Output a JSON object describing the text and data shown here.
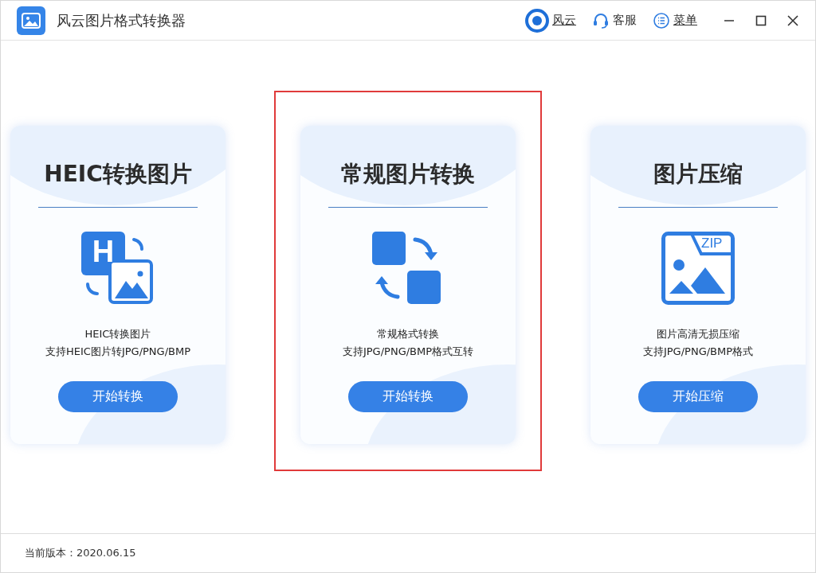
{
  "window": {
    "title": "风云图片格式转换器"
  },
  "header_links": [
    {
      "kind": "brand",
      "label": "风云"
    },
    {
      "kind": "service",
      "label": "客服"
    },
    {
      "kind": "menu",
      "label": "菜单"
    }
  ],
  "cards": [
    {
      "kind": "heic",
      "title": "HEIC转换图片",
      "icon_text": "H",
      "lines": [
        "HEIC转换图片",
        "支持HEIC图片转JPG/PNG/BMP"
      ],
      "button": "开始转换",
      "selected": false
    },
    {
      "kind": "convert",
      "title": "常规图片转换",
      "lines": [
        "常规格式转换",
        "支持JPG/PNG/BMP格式互转"
      ],
      "button": "开始转换",
      "selected": true
    },
    {
      "kind": "zip",
      "title": "图片压缩",
      "icon_text": "ZIP",
      "lines": [
        "图片高清无损压缩",
        "支持JPG/PNG/BMP格式"
      ],
      "button": "开始压缩",
      "selected": false
    }
  ],
  "status_bar": {
    "version": "当前版本：2020.06.15"
  }
}
